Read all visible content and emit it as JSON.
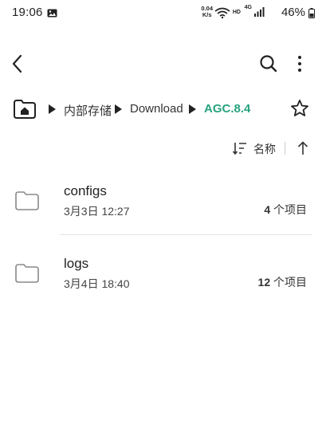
{
  "status_bar": {
    "time": "19:06",
    "net_speed_value": "0.04",
    "net_speed_unit": "K/s",
    "hd": "HD",
    "network": "4G",
    "battery": "46%"
  },
  "toolbar": {
    "back_icon": "chevron-left-icon",
    "search_icon": "search-icon",
    "more_icon": "more-vertical-icon"
  },
  "breadcrumb": {
    "items": [
      {
        "label": "内部存储"
      },
      {
        "label": "Download"
      },
      {
        "label": "AGC.8.4"
      }
    ],
    "active_color": "#27a37e"
  },
  "sort": {
    "label": "名称"
  },
  "files": [
    {
      "name": "configs",
      "date": "3月3日 12:27",
      "count": "4",
      "count_suffix": " 个项目"
    },
    {
      "name": "logs",
      "date": "3月4日 18:40",
      "count": "12",
      "count_suffix": " 个项目"
    }
  ]
}
